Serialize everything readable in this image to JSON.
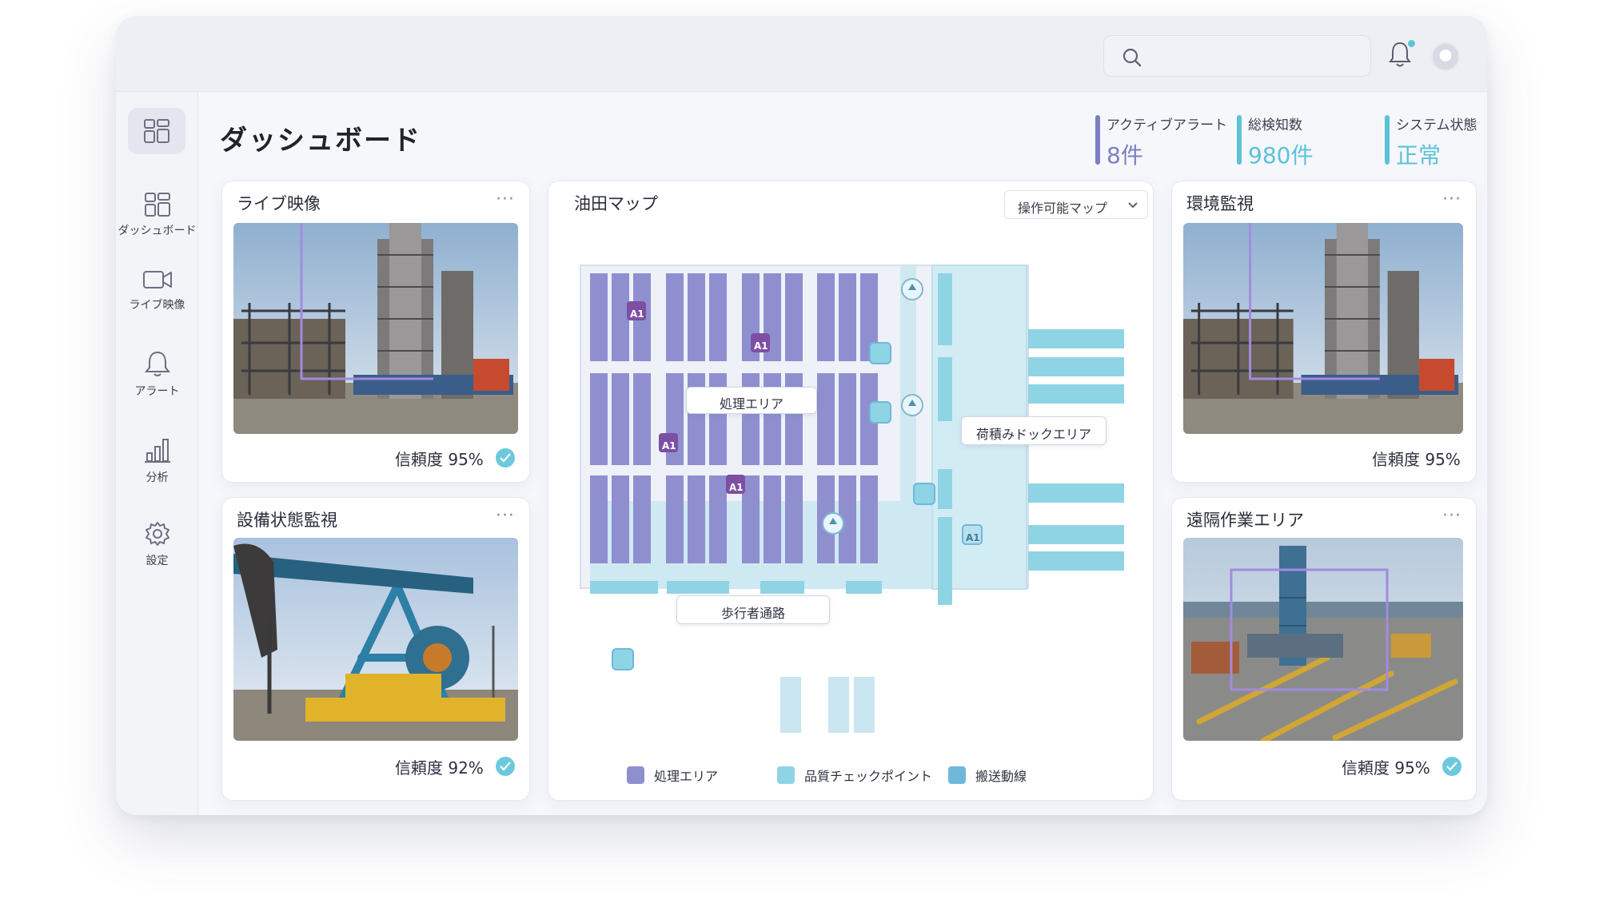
{
  "header": {
    "title": "ダッシュボード",
    "search_placeholder": ""
  },
  "sidebar": {
    "items": [
      {
        "label": "ダッシュボード",
        "icon": "grid-icon"
      },
      {
        "label": "ライブ映像",
        "icon": "video-camera-icon"
      },
      {
        "label": "アラート",
        "icon": "bell-icon"
      },
      {
        "label": "分析",
        "icon": "bar-chart-icon"
      },
      {
        "label": "設定",
        "icon": "gear-icon"
      }
    ]
  },
  "stats": [
    {
      "label": "アクティブアラート",
      "value": "8件",
      "color": "#7b7fc2"
    },
    {
      "label": "総検知数",
      "value": "980件",
      "color": "#5ac3d8"
    },
    {
      "label": "システム状態",
      "value": "正常",
      "color": "#5ac3d8"
    }
  ],
  "cards": {
    "live": {
      "title": "ライブ映像",
      "more": "···",
      "confidence_label": "信頼度",
      "confidence": "95%"
    },
    "equipment": {
      "title": "設備状態監視",
      "more": "···",
      "confidence_label": "信頼度",
      "confidence": "92%"
    },
    "environment": {
      "title": "環境監視",
      "more": "···",
      "confidence_label": "信頼度",
      "confidence": "95%"
    },
    "remote": {
      "title": "遠隔作業エリア",
      "more": "···",
      "confidence_label": "信頼度",
      "confidence": "95%"
    }
  },
  "map": {
    "title": "油田マップ",
    "view_select": "操作可能マップ",
    "labels": {
      "processing": "処理エリア",
      "loading_dock": "荷積みドックエリア",
      "walkway": "歩行者通路"
    },
    "marker_text": "A1",
    "legend": [
      {
        "label": "処理エリア",
        "color": "#8f8fd0"
      },
      {
        "label": "品質チェックポイント",
        "color": "#8fd4e4"
      },
      {
        "label": "搬送動線",
        "color": "#6fb8dc"
      }
    ]
  }
}
